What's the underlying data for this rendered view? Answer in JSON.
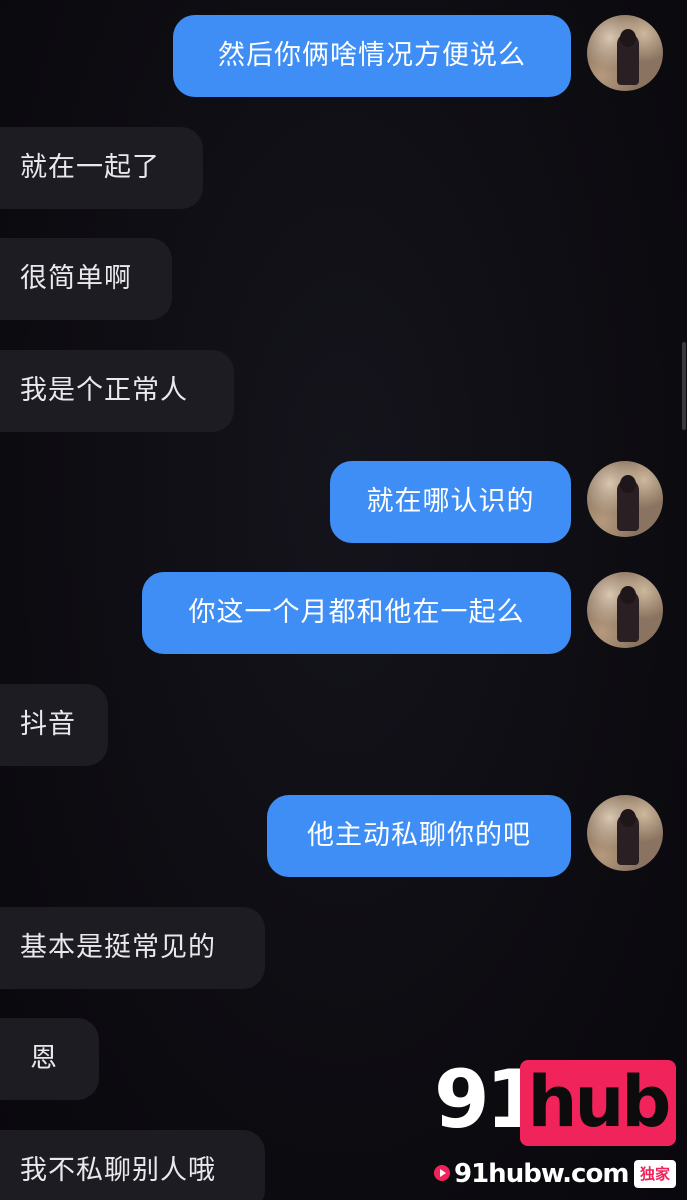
{
  "messages": [
    {
      "side": "right",
      "text": "然后你俩啥情况方便说么"
    },
    {
      "side": "left",
      "text": "就在一起了"
    },
    {
      "side": "left",
      "text": "很简单啊"
    },
    {
      "side": "left",
      "text": "我是个正常人"
    },
    {
      "side": "right",
      "text": "就在哪认识的"
    },
    {
      "side": "right",
      "text": "你这一个月都和他在一起么"
    },
    {
      "side": "left",
      "text": "抖音"
    },
    {
      "side": "right",
      "text": "他主动私聊你的吧"
    },
    {
      "side": "left",
      "text": "基本是挺常见的"
    },
    {
      "side": "left",
      "text": "恩"
    },
    {
      "side": "left",
      "text": "我不私聊别人哦"
    }
  ],
  "watermark": {
    "number": "91",
    "brand": "hub",
    "url": "91hubw.com",
    "badge": "独家"
  },
  "colors": {
    "background": "#0d0c12",
    "right_bubble": "#3f8ef5",
    "left_bubble": "#1d1c22",
    "brand_accent": "#f0245a"
  }
}
